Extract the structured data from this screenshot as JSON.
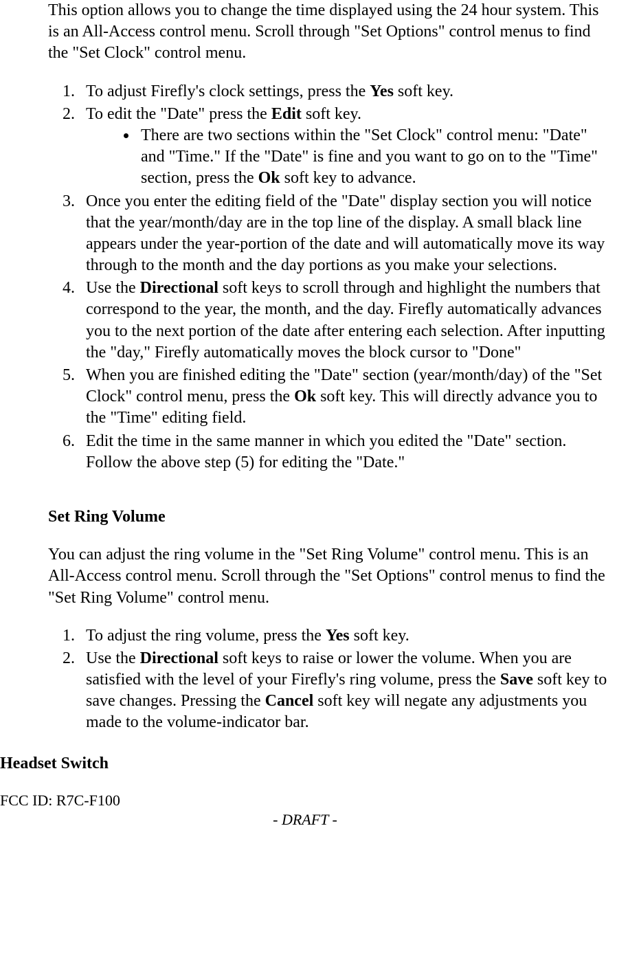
{
  "intro1": "This option allows you to change the time displayed using the 24 hour system.  This is an All-Access control menu.  Scroll through \"Set Options\" control menus to find the \"Set Clock\" control menu.",
  "list1": {
    "item1_a": "To adjust Firefly's clock settings, press the ",
    "item1_b": "Yes",
    "item1_c": " soft key.",
    "item2_a": "To edit the \"Date\" press the ",
    "item2_b": "Edit",
    "item2_c": " soft key.",
    "sub1_a": "There are two sections within the \"Set Clock\" control menu: \"Date\" and \"Time.\" If the \"Date\" is fine and you want to go on to the \"Time\" section, press the ",
    "sub1_b": "Ok",
    "sub1_c": " soft key to advance.",
    "item3": "Once you enter the editing field of the \"Date\" display section you will notice that the year/month/day are in the top line of the display.  A small black line appears under the year-portion of the date and will automatically move its way through to the month and the day portions as you make your selections.",
    "item4_a": "Use the ",
    "item4_b": "Directional",
    "item4_c": " soft keys to scroll through and highlight the numbers that correspond to the year, the month, and the day.  Firefly automatically advances you to the next portion of the date after entering each selection.  After inputting the \"day,\" Firefly automatically moves the block cursor to \"Done\"",
    "item5_a": "When you are finished editing the \"Date\" section (year/month/day) of the \"Set Clock\" control menu, press the ",
    "item5_b": "Ok",
    "item5_c": " soft key.  This will directly advance you to the \"Time\" editing field.",
    "item6": "Edit the time in the same manner in which you edited the \"Date\" section.  Follow the above step (5) for editing the \"Date.\""
  },
  "heading2": "Set Ring Volume",
  "intro2": "You can adjust the ring volume in the \"Set Ring Volume\" control menu.  This is an All-Access control menu. Scroll through the \"Set Options\" control menus to find the \"Set Ring Volume\" control menu.",
  "list2": {
    "item1_a": "To adjust the ring volume, press the ",
    "item1_b": "Yes",
    "item1_c": " soft key.",
    "item2_a": "Use the ",
    "item2_b": "Directional",
    "item2_c": " soft keys to raise or lower the volume.  When you are satisfied with the level of your Firefly's ring volume, press the ",
    "item2_d": "Save",
    "item2_e": " soft key to save changes.  Pressing the ",
    "item2_f": "Cancel",
    "item2_g": " soft key will negate any adjustments you made to the volume-indicator bar."
  },
  "heading3": "Headset Switch",
  "footer_id": "FCC ID: R7C-F100",
  "draft": "- DRAFT -"
}
